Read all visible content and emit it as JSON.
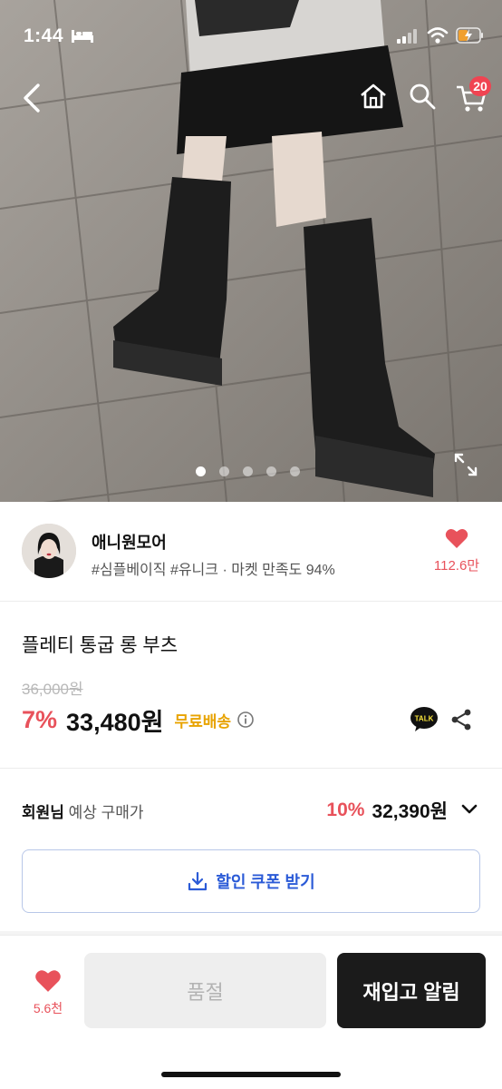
{
  "status_bar": {
    "time": "1:44",
    "battery_color": "#f0a030"
  },
  "nav": {
    "cart_count": "20"
  },
  "hero": {
    "image_desc_icon": "product-photo",
    "slide_count": 5,
    "active_slide": 1
  },
  "seller": {
    "name": "애니원모어",
    "meta": "#심플베이직 #유니크 · 마켓 만족도 94%",
    "like_count": "112.6만"
  },
  "product": {
    "title": "플레티 통굽 롱 부츠",
    "original_price": "36,000원",
    "discount": "7%",
    "price": "33,480원",
    "shipping": "무료배송"
  },
  "member": {
    "label_bold": "회원님",
    "label_rest": " 예상 구매가",
    "discount": "10%",
    "price": "32,390원"
  },
  "coupon": {
    "label": "할인 쿠폰 받기"
  },
  "bottom": {
    "like_count": "5.6천",
    "soldout_label": "품절",
    "restock_label": "재입고 알림"
  },
  "colors": {
    "accent_red": "#e8525b",
    "shipping_orange": "#e8a300",
    "coupon_blue": "#2b5bd7",
    "dark_button": "#1b1b1b"
  }
}
